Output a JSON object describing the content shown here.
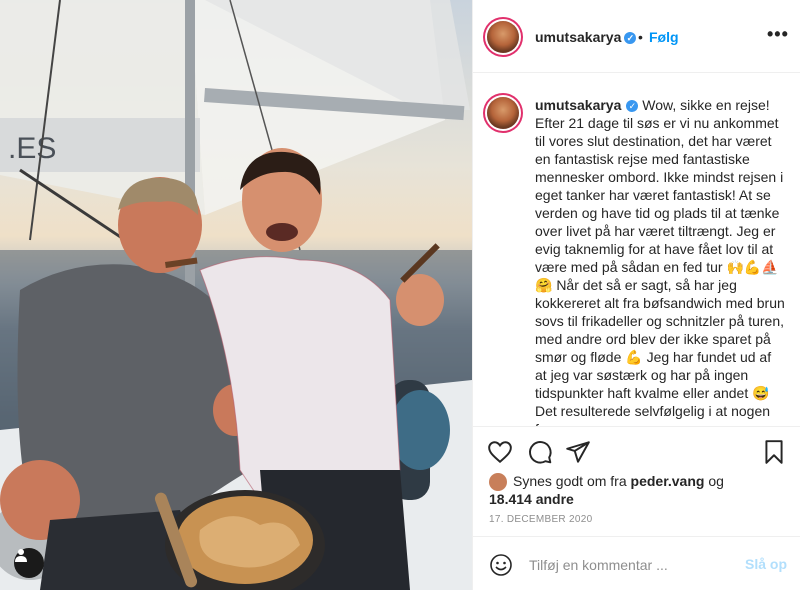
{
  "post": {
    "username": "umutsakarya",
    "follow_label": "Følg",
    "dot": "•",
    "more": "•••",
    "caption": "Wow, sikke en rejse! Efter 21 dage til søs er vi nu ankommet til vores slut destination, det har været en fantastisk rejse med fantastiske mennesker ombord. Ikke mindst rejsen i eget tanker har været fantastisk! At se verden og have tid og plads til at tænke over livet på har været tiltrængt. Jeg er evig taknemlig for at have fået lov til at være med på sådan en fed tur 🙌💪⛵🤗 Når det så er sagt, så har jeg kokkereret alt fra bøfsandwich med brun sovs til frikadeller og schnitzler på turen, med andre ord blev der ikke sparet på smør og fløde 💪 Jeg har fundet ud af at jeg var søstærk og har på ingen tidspunkter haft kvalme eller andet 😅 Det resulterede selvfølgelig i at nogen for",
    "likes_prefix": "Synes godt om fra",
    "likes_user": "peder.vang",
    "likes_and": "og",
    "likes_count": "18.414 andre",
    "date": "17. DECEMBER 2020",
    "comment_placeholder": "Tilføj en kommentar ...",
    "post_label": "Slå op"
  },
  "photo": {
    "sail_text": ".ES"
  },
  "icons": [
    "verified-badge",
    "heart-icon",
    "comment-icon",
    "share-icon",
    "bookmark-icon",
    "emoji-icon",
    "user-tag-icon"
  ],
  "colors": {
    "accent": "#0095f6",
    "verified": "#3897f0",
    "post_disabled": "#b2dffc",
    "muted": "#8e8e8e"
  }
}
